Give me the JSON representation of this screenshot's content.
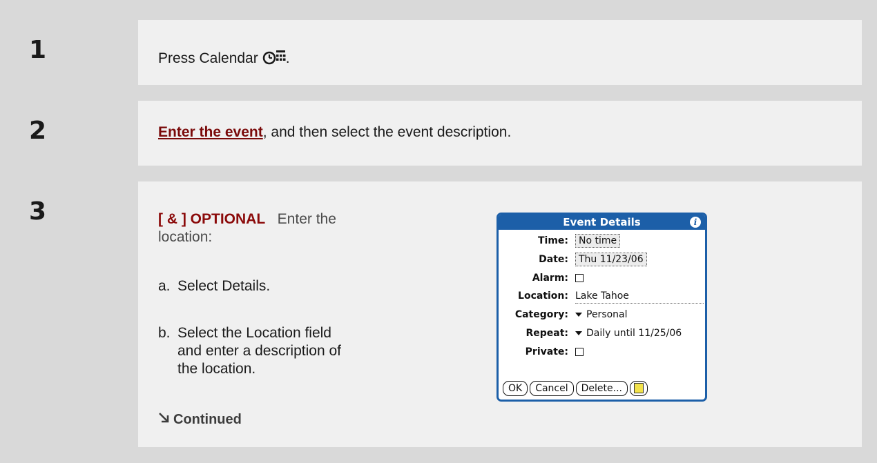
{
  "steps": [
    {
      "number": "1",
      "text_before": "Press Calendar",
      "icon": "calendar-app-icon",
      "text_after": "."
    },
    {
      "number": "2",
      "link_text": "Enter the event",
      "text_after": ", and then select the event description."
    },
    {
      "number": "3",
      "optional_tag": "[ & ]  OPTIONAL",
      "optional_text": "Enter the location:",
      "items": [
        {
          "letter": "a.",
          "text": "Select Details."
        },
        {
          "letter": "b.",
          "text": "Select the Location field and enter a description of the location."
        }
      ],
      "continued": "Continued"
    }
  ],
  "dialog": {
    "title": "Event Details",
    "fields": {
      "time_label": "Time:",
      "time_value": "No time",
      "date_label": "Date:",
      "date_value": "Thu 11/23/06",
      "alarm_label": "Alarm:",
      "location_label": "Location:",
      "location_value": "Lake Tahoe",
      "category_label": "Category:",
      "category_value": "Personal",
      "repeat_label": "Repeat:",
      "repeat_value": "Daily until 11/25/06",
      "private_label": "Private:"
    },
    "buttons": {
      "ok": "OK",
      "cancel": "Cancel",
      "delete": "Delete..."
    }
  },
  "colors": {
    "number_column": "#d9d9d9",
    "content_bg": "#f0f0f0",
    "link": "#7a0a0a",
    "optional_tag": "#8b0a0a",
    "dialog_blue": "#1c5fa8"
  }
}
